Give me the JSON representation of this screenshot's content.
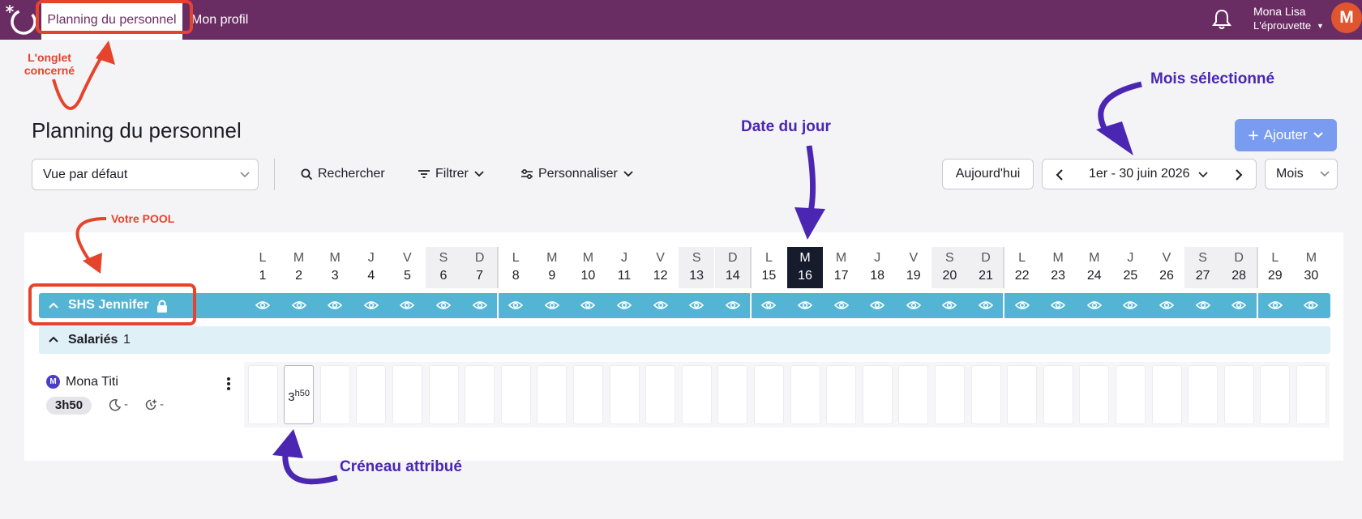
{
  "nav": {
    "active_tab": "Planning du personnel",
    "profile_tab": "Mon profil",
    "user_name": "Mona Lisa",
    "user_org": "L'éprouvette",
    "avatar_letter": "M"
  },
  "annotations": {
    "tab": "L'onglet concerné",
    "pool": "Votre POOL",
    "today": "Date du jour",
    "month": "Mois sélectionné",
    "slot": "Créneau attribué"
  },
  "page": {
    "title": "Planning du personnel",
    "add_button": "Ajouter"
  },
  "toolbar": {
    "view": "Vue par défaut",
    "search": "Rechercher",
    "filter": "Filtrer",
    "customize": "Personnaliser",
    "today": "Aujourd'hui",
    "period": "1er - 30 juin 2026",
    "mode": "Mois"
  },
  "days": [
    {
      "l": "L",
      "n": "1"
    },
    {
      "l": "M",
      "n": "2"
    },
    {
      "l": "M",
      "n": "3"
    },
    {
      "l": "J",
      "n": "4"
    },
    {
      "l": "V",
      "n": "5"
    },
    {
      "l": "S",
      "n": "6"
    },
    {
      "l": "D",
      "n": "7"
    },
    {
      "l": "L",
      "n": "8"
    },
    {
      "l": "M",
      "n": "9"
    },
    {
      "l": "M",
      "n": "10"
    },
    {
      "l": "J",
      "n": "11"
    },
    {
      "l": "V",
      "n": "12"
    },
    {
      "l": "S",
      "n": "13"
    },
    {
      "l": "D",
      "n": "14"
    },
    {
      "l": "L",
      "n": "15"
    },
    {
      "l": "M",
      "n": "16"
    },
    {
      "l": "M",
      "n": "17"
    },
    {
      "l": "J",
      "n": "18"
    },
    {
      "l": "V",
      "n": "19"
    },
    {
      "l": "S",
      "n": "20"
    },
    {
      "l": "D",
      "n": "21"
    },
    {
      "l": "L",
      "n": "22"
    },
    {
      "l": "M",
      "n": "23"
    },
    {
      "l": "M",
      "n": "24"
    },
    {
      "l": "J",
      "n": "25"
    },
    {
      "l": "V",
      "n": "26"
    },
    {
      "l": "S",
      "n": "27"
    },
    {
      "l": "D",
      "n": "28"
    },
    {
      "l": "L",
      "n": "29"
    },
    {
      "l": "M",
      "n": "30"
    }
  ],
  "today_day": "16",
  "pool": {
    "name": "SHS Jennifer"
  },
  "group": {
    "name": "Salariés",
    "count": "1"
  },
  "employee": {
    "initial": "M",
    "name": "Mona Titi",
    "hours": "3h50",
    "night": "-",
    "overtime": "-",
    "slot_hours": "3",
    "slot_minutes": "h50",
    "slot_day": "2"
  },
  "colors": {
    "nav": "#6a2d63",
    "pool": "#53b5d3",
    "group": "#dff0f7",
    "today": "#171c2d",
    "add": "#7a9cf0",
    "annotation_red": "#e5432c",
    "annotation_purple": "#4a26b3"
  }
}
